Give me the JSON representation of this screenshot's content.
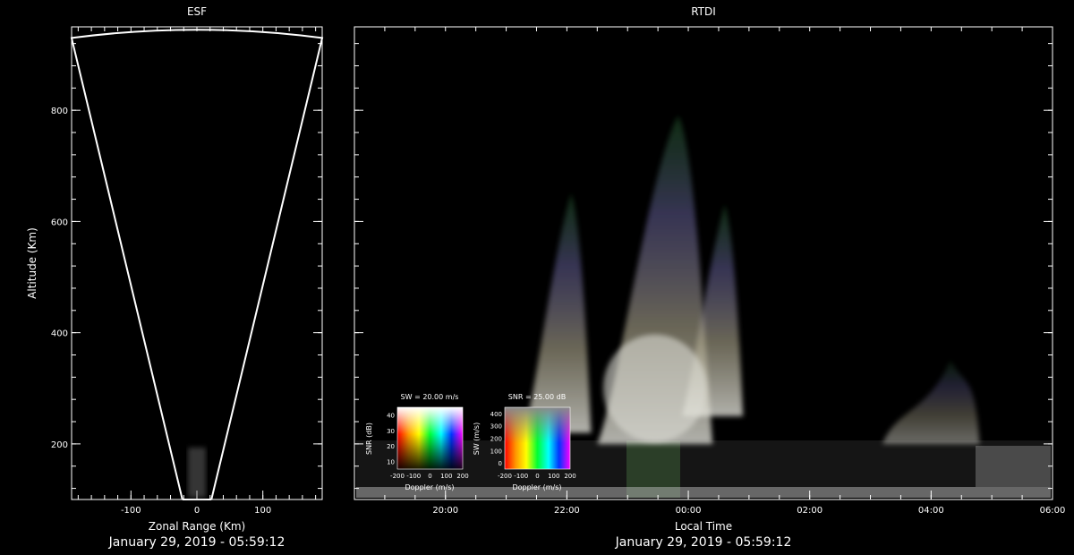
{
  "colors": {
    "background": "#000000",
    "axes": "#ffffff",
    "fan": "#ffffff"
  },
  "chart_data": [
    {
      "panel": "esf",
      "type": "scatter",
      "title": "ESF",
      "xlabel": "Zonal Range (Km)",
      "ylabel": "Altitude (Km)",
      "xlim": [
        -190,
        190
      ],
      "ylim": [
        100,
        950
      ],
      "xticks": [
        -100,
        0,
        100
      ],
      "yticks": [
        200,
        400,
        600,
        800
      ],
      "fan_outline": [
        [
          -22,
          100
        ],
        [
          -190,
          930
        ],
        [
          0,
          950
        ],
        [
          190,
          930
        ],
        [
          22,
          100
        ]
      ],
      "footer": "January 29, 2019 - 05:59:12"
    },
    {
      "panel": "rtdi",
      "type": "heatmap",
      "title": "RTDI",
      "xlabel": "Local Time",
      "ylabel": "Altitude (Km)",
      "xlim": [
        18.5,
        30.0
      ],
      "ylim": [
        100,
        950
      ],
      "xticks": [
        "20:00",
        "22:00",
        "00:00",
        "02:00",
        "04:00",
        "06:00"
      ],
      "xtick_values": [
        20,
        22,
        24,
        26,
        28,
        30
      ],
      "yticks": [
        200,
        400,
        600,
        800
      ],
      "plumes": [
        {
          "t0": 21.3,
          "t1": 22.4,
          "base": 220,
          "top": 650
        },
        {
          "t0": 22.5,
          "t1": 24.4,
          "base": 200,
          "top": 790
        },
        {
          "t0": 23.9,
          "t1": 24.9,
          "base": 250,
          "top": 630
        },
        {
          "t0": 27.2,
          "t1": 28.8,
          "base": 200,
          "top": 350
        }
      ],
      "footer": "January 29, 2019 - 05:59:12"
    }
  ],
  "legend_doppler_sw": {
    "title": "SW = 20.00 m/s",
    "xlabel": "Doppler (m/s)",
    "ylabel": "SNR (dB)",
    "xticks": [
      "-200",
      "-100",
      "0",
      "100",
      "200"
    ],
    "yticks": [
      "10",
      "20",
      "30",
      "40"
    ]
  },
  "legend_doppler_snr": {
    "title": "SNR = 25.00 dB",
    "xlabel": "Doppler (m/s)",
    "ylabel": "SW (m/s)",
    "xticks": [
      "-200",
      "-100",
      "0",
      "100",
      "200"
    ],
    "yticks": [
      "0",
      "100",
      "200",
      "300",
      "400"
    ]
  }
}
